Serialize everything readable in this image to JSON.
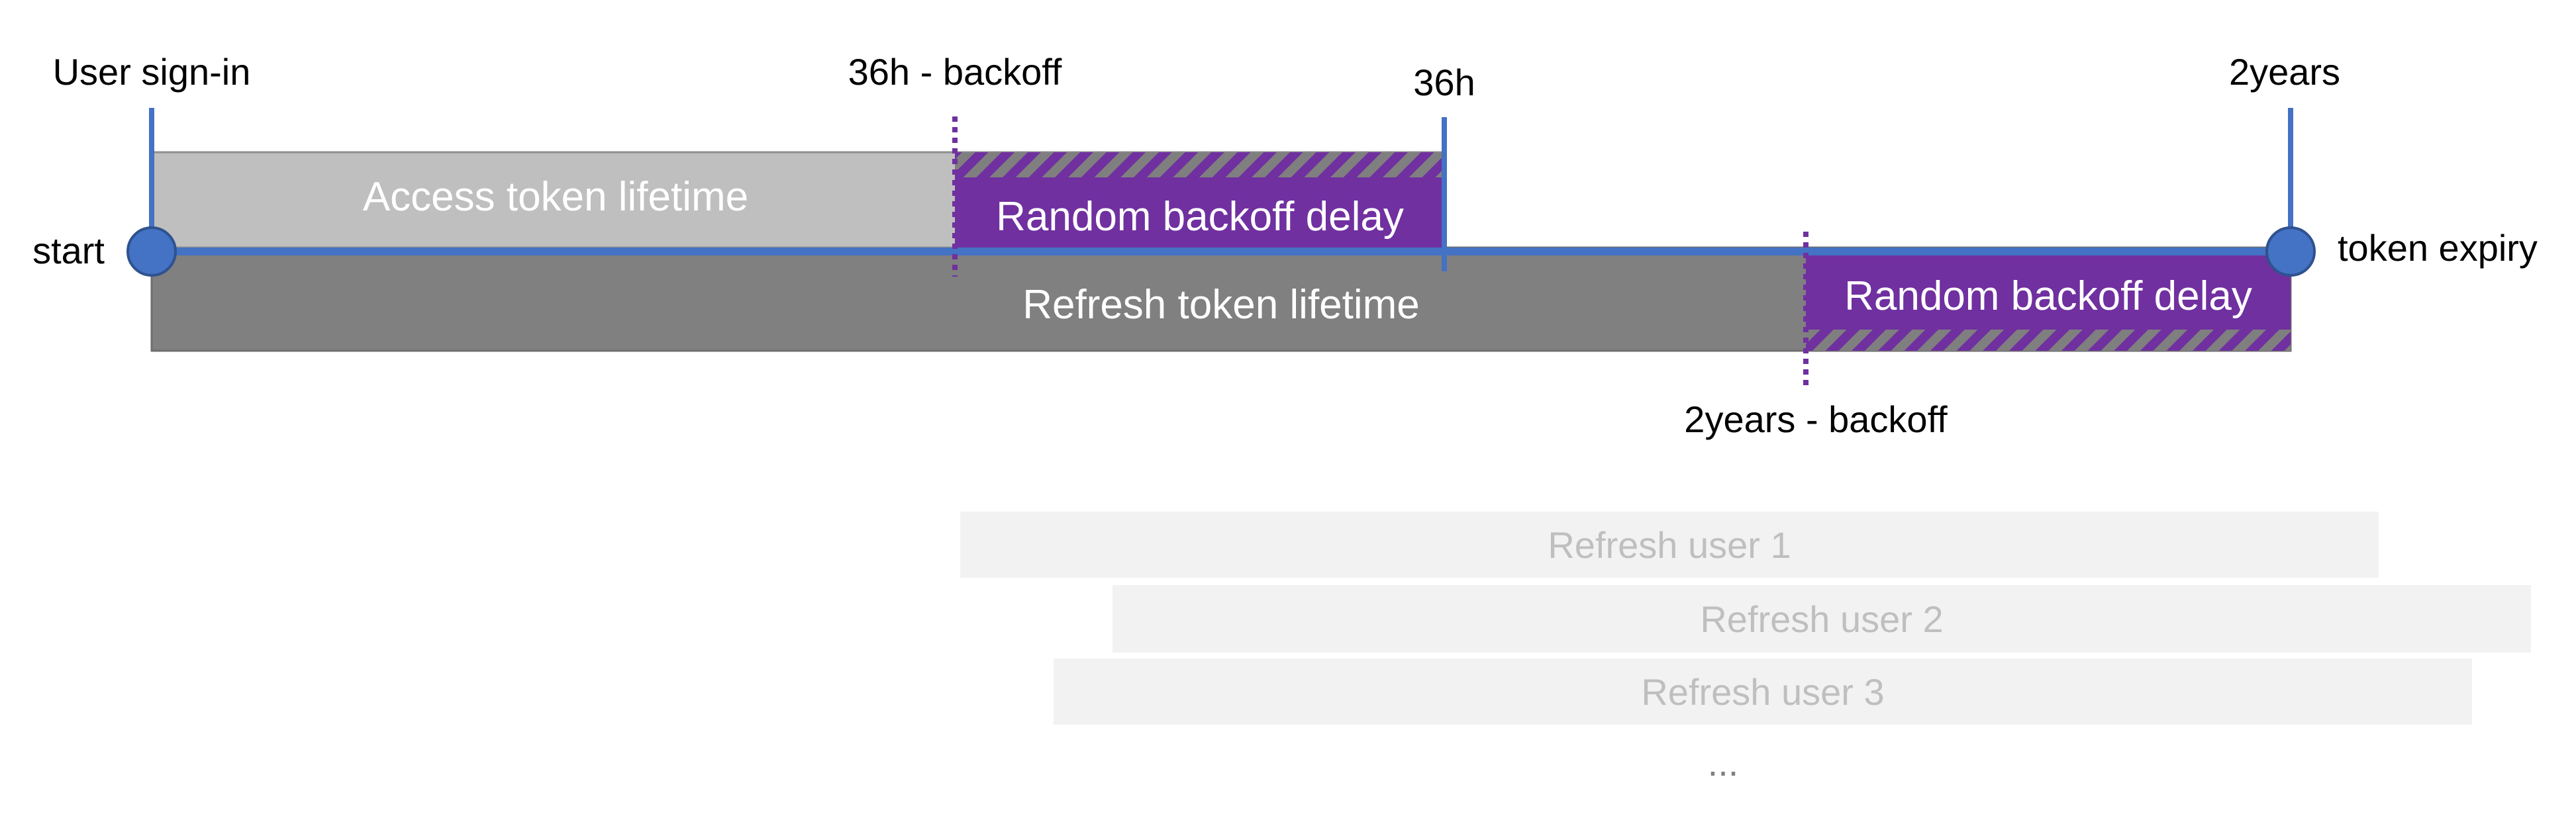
{
  "labels": {
    "user_signin": "User sign-in",
    "backoff_36h": "36h - backoff",
    "mark_36h": "36h",
    "mark_2years": "2years",
    "start": "start",
    "token_expiry": "token expiry",
    "backoff_2years": "2years - backoff"
  },
  "bars": {
    "access_token": "Access token lifetime",
    "refresh_token": "Refresh token lifetime",
    "random_backoff_1": "Random backoff delay",
    "random_backoff_2": "Random backoff delay"
  },
  "refresh_users": [
    "Refresh user 1",
    "Refresh user 2",
    "Refresh user 3"
  ],
  "ellipsis": "...",
  "colors": {
    "timeline_blue": "#4472C4",
    "access_gray": "#BFBFBF",
    "refresh_gray": "#808080",
    "backoff_purple": "#7030A0",
    "refresh_user_bg": "#F2F2F2",
    "refresh_user_text": "#BFBFBF"
  }
}
